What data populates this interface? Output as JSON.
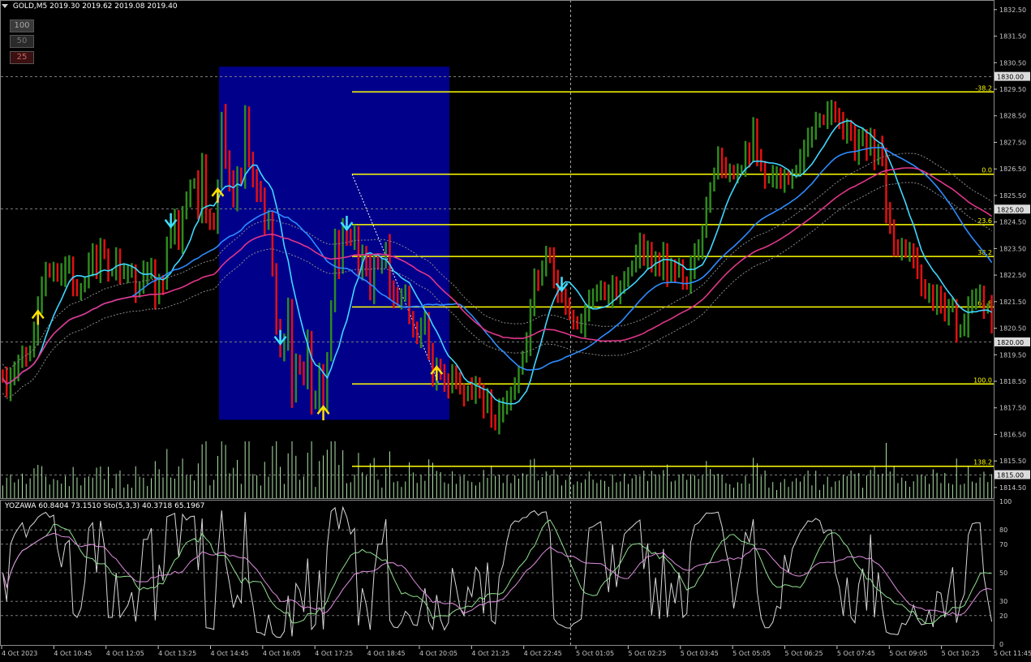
{
  "header": {
    "symbol": "GOLD,M5",
    "ohlc": "2019.30 2019.62 2019.08 2019.40"
  },
  "buttons": [
    {
      "label": "100"
    },
    {
      "label": "50"
    },
    {
      "label": "25"
    }
  ],
  "subwindow": {
    "label": "YOZAWA 60.8404 73.1510  Sto(5,3,3) 40.3718 65.1967"
  },
  "chart_data": {
    "type": "bar",
    "timeframe": "M5",
    "grid": false,
    "price_axis_labels": [
      "1832.50",
      "1831.50",
      "1830.50",
      "1829.50",
      "1828.50",
      "1827.50",
      "1826.50",
      "1825.50",
      "1824.50",
      "1823.50",
      "1822.50",
      "1821.50",
      "1820.50",
      "1819.50",
      "1818.50",
      "1817.50",
      "1816.50",
      "1815.50",
      "1814.50"
    ],
    "price_tags": [
      {
        "price": 1830.0,
        "label": "1830.00"
      },
      {
        "price": 1825.0,
        "label": "1825.00"
      },
      {
        "price": 1820.0,
        "label": "1820.00"
      },
      {
        "price": 1815.0,
        "label": "1815.00"
      }
    ],
    "time_labels": [
      "4 Oct 2023",
      "4 Oct 10:45",
      "4 Oct 12:05",
      "4 Oct 13:25",
      "4 Oct 14:45",
      "4 Oct 16:05",
      "4 Oct 17:25",
      "4 Oct 18:45",
      "4 Oct 20:05",
      "4 Oct 21:25",
      "4 Oct 22:45",
      "5 Oct 01:05",
      "5 Oct 02:25",
      "5 Oct 03:45",
      "5 Oct 05:05",
      "5 Oct 06:25",
      "5 Oct 07:45",
      "5 Oct 09:05",
      "5 Oct 10:25",
      "5 Oct 11:45"
    ],
    "fibonacci_levels": [
      {
        "label": "-38.2",
        "price": 1829.4
      },
      {
        "label": "0.0",
        "price": 1826.3
      },
      {
        "label": "23.6",
        "price": 1824.4
      },
      {
        "label": "38.2",
        "price": 1823.2
      },
      {
        "label": "61.8",
        "price": 1821.3
      },
      {
        "label": "100.0",
        "price": 1818.4
      },
      {
        "label": "138.2",
        "price": 1815.3
      }
    ],
    "oscillator_levels": [
      "100",
      "80",
      "70",
      "50",
      "30",
      "20",
      "0"
    ],
    "closes": [
      1818.6,
      1818.2,
      1818.6,
      1818.9,
      1819.2,
      1819.6,
      1819.4,
      1819.7,
      1820.3,
      1821.3,
      1822.1,
      1822.7,
      1822.6,
      1822.8,
      1822.4,
      1822.5,
      1822.8,
      1822.9,
      1822.1,
      1821.9,
      1822.0,
      1822.3,
      1822.9,
      1823.3,
      1822.6,
      1823.6,
      1823.3,
      1822.6,
      1822.6,
      1823.1,
      1822.6,
      1822.6,
      1822.6,
      1822.7,
      1821.8,
      1822.1,
      1822.6,
      1822.6,
      1822.8,
      1821.6,
      1822.3,
      1822.1,
      1823.8,
      1824.1,
      1824.6,
      1823.7,
      1824.8,
      1825.4,
      1825.9,
      1826.0,
      1824.9,
      1826.7,
      1824.7,
      1824.6,
      1824.4,
      1825.9,
      1828.5,
      1826.8,
      1826.1,
      1825.3,
      1826.3,
      1826.1,
      1828.7,
      1826.7,
      1826.1,
      1825.7,
      1825.5,
      1824.4,
      1824.7,
      1822.8,
      1820.4,
      1819.7,
      1819.9,
      1821.3,
      1817.9,
      1819.3,
      1819.1,
      1818.5,
      1820.0,
      1817.7,
      1817.8,
      1818.9,
      1817.7,
      1819.4,
      1821.4,
      1823.8,
      1822.8,
      1824.3,
      1824.0,
      1823.8,
      1824.2,
      1822.6,
      1823.2,
      1822.9,
      1821.8,
      1823.0,
      1822.9,
      1822.9,
      1823.6,
      1821.9,
      1821.7,
      1821.6,
      1821.7,
      1821.9,
      1821.0,
      1820.3,
      1820.2,
      1820.5,
      1820.8,
      1819.7,
      1818.5,
      1819.2,
      1818.7,
      1818.4,
      1818.3,
      1818.8,
      1818.6,
      1818.2,
      1817.9,
      1818.2,
      1818.1,
      1818.3,
      1818.1,
      1817.5,
      1818.0,
      1817.1,
      1816.8,
      1817.4,
      1817.5,
      1817.8,
      1818.0,
      1818.4,
      1818.9,
      1819.5,
      1819.9,
      1821.2,
      1822.4,
      1822.3,
      1822.8,
      1823.4,
      1823.1,
      1822.3,
      1821.9,
      1821.7,
      1821.4,
      1821.0,
      1820.8,
      1820.6,
      1820.6,
      1821.0,
      1821.6,
      1821.7,
      1821.9,
      1822.1,
      1821.7,
      1821.7,
      1822.1,
      1821.8,
      1822.0,
      1822.4,
      1822.6,
      1822.9,
      1823.2,
      1823.7,
      1823.1,
      1823.5,
      1822.8,
      1823.2,
      1822.6,
      1823.3,
      1822.5,
      1822.8,
      1822.6,
      1822.9,
      1822.3,
      1822.1,
      1822.8,
      1823.3,
      1823.5,
      1824.1,
      1825.2,
      1825.8,
      1826.4,
      1826.9,
      1826.6,
      1826.4,
      1826.4,
      1826.3,
      1826.5,
      1826.5,
      1827.1,
      1827.0,
      1828.1,
      1827.0,
      1826.6,
      1826.1,
      1826.1,
      1826.2,
      1826.2,
      1826.0,
      1826.2,
      1826.1,
      1826.3,
      1826.5,
      1826.8,
      1827.2,
      1827.7,
      1827.8,
      1828.4,
      1828.4,
      1828.3,
      1828.6,
      1828.7,
      1828.5,
      1828.4,
      1827.8,
      1828.2,
      1827.7,
      1827.1,
      1827.6,
      1827.7,
      1827.2,
      1827.8,
      1826.8,
      1827.3,
      1826.9,
      1824.9,
      1824.3,
      1823.6,
      1823.4,
      1823.7,
      1823.3,
      1823.3,
      1823.2,
      1822.6,
      1822.1,
      1821.8,
      1822.0,
      1821.3,
      1821.7,
      1821.5,
      1821.0,
      1821.3,
      1821.4,
      1820.3,
      1820.5,
      1820.6,
      1821.3,
      1821.6,
      1821.7,
      1821.9,
      1821.2,
      1821.3,
      1820.6
    ],
    "moving_averages": [
      {
        "color": "#3fd7ff",
        "type": "fast"
      },
      {
        "color": "#2d8cff",
        "type": "medium"
      },
      {
        "color": "#e0368a",
        "type": "slow"
      }
    ],
    "signals": [
      {
        "bar": 9,
        "dir": "up"
      },
      {
        "bar": 43,
        "dir": "down"
      },
      {
        "bar": 55,
        "dir": "up"
      },
      {
        "bar": 71,
        "dir": "down"
      },
      {
        "bar": 82,
        "dir": "up"
      },
      {
        "bar": 88,
        "dir": "down"
      },
      {
        "bar": 111,
        "dir": "up"
      },
      {
        "bar": 143,
        "dir": "down"
      }
    ],
    "colors": {
      "up_bar": "#2e8a1e",
      "down_bar": "#e21010",
      "fib": "#ffff00",
      "box": "#00008b",
      "volume": "#aee6a6",
      "axis": "#c8c8c8"
    }
  }
}
